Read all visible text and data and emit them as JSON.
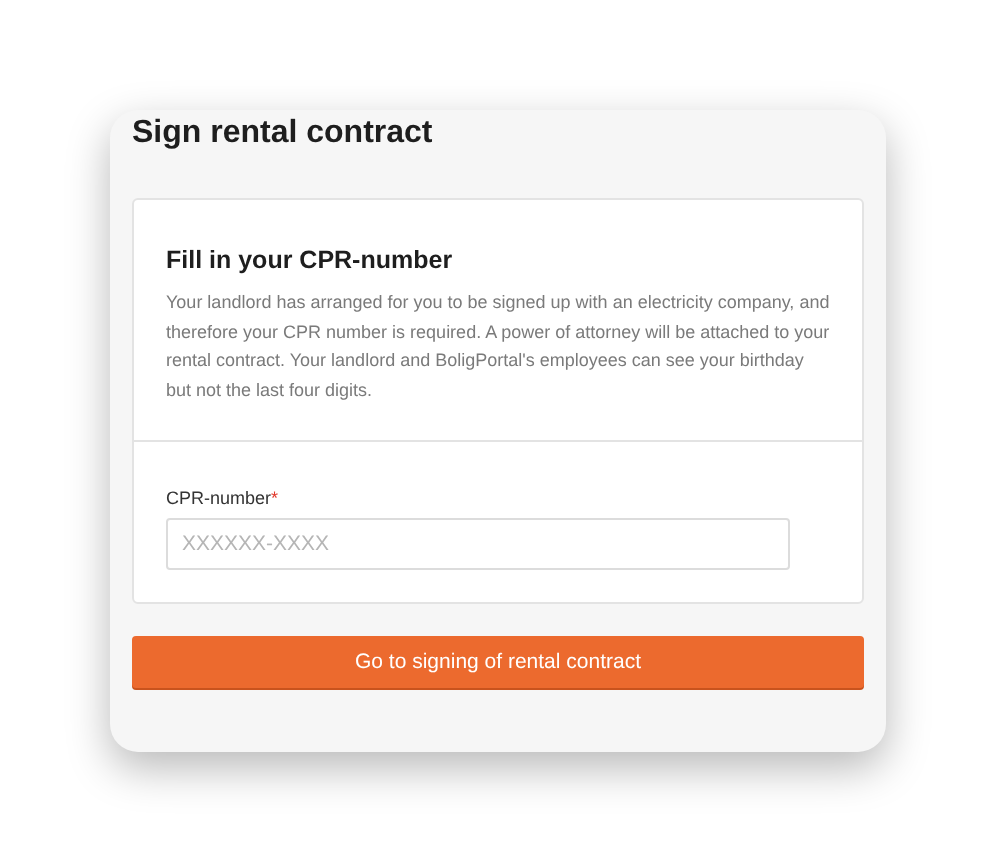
{
  "dialog": {
    "title": "Sign rental contract"
  },
  "section": {
    "heading": "Fill in your CPR-number",
    "description": "Your landlord has arranged for you to be signed up with an electricity company, and therefore your CPR number is required. A power of attorney will be attached to your rental contract. Your landlord and BoligPortal's employees can see your birthday but not the last four digits."
  },
  "field": {
    "label": "CPR-number",
    "required_mark": "*",
    "placeholder": "XXXXXX-XXXX"
  },
  "button": {
    "label": "Go to signing of rental contract"
  }
}
